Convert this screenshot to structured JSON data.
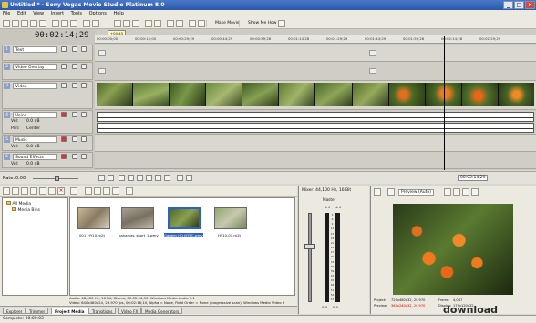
{
  "window": {
    "title": "Untitled * - Sony Vegas Movie Studio Platinum 8.0"
  },
  "menu": [
    "File",
    "Edit",
    "View",
    "Insert",
    "Tools",
    "Options",
    "Help"
  ],
  "toolbar": {
    "make_movie": "Make Movie",
    "show_me_how": "Show Me How"
  },
  "timecode": "00:02:14;29",
  "ruler_labels": [
    "00:00:00;00",
    "00:00:15;00",
    "00:00:29;29",
    "00:00:44;29",
    "00:00:59;28",
    "00:01:14;28",
    "00:01:29;29",
    "00:01:44;29",
    "00:01:59;28",
    "00:02:14;28",
    "00:02:29;29"
  ],
  "marker": "+00:45",
  "tracks": [
    {
      "num": "1",
      "name": "Text"
    },
    {
      "num": "2",
      "name": "Video Overlay"
    },
    {
      "num": "3",
      "name": "Video"
    },
    {
      "num": "4",
      "name": "Voice",
      "vol_label": "Vol:",
      "vol": "0.0 dB",
      "pan_label": "Pan:",
      "pan": "Center"
    },
    {
      "num": "5",
      "name": "Music",
      "vol_label": "Vol:",
      "vol": "0.0 dB"
    },
    {
      "num": "6",
      "name": "Sound Effects",
      "vol_label": "Vol:",
      "vol": "0.0 dB"
    }
  ],
  "rate": {
    "label": "Rate:",
    "value": "0.00"
  },
  "transport_time": "00:02:14;29",
  "explorer": {
    "tree": [
      "All Media",
      "Media Bins"
    ],
    "media": [
      {
        "name": "001_HY10.m2t"
      },
      {
        "name": "bahamas_short_1.wmv"
      },
      {
        "name": "Garden HQ NTSC.wmv"
      },
      {
        "name": "HY10-01.m2t"
      }
    ],
    "info_lines": [
      "Audio: 48,000 Hz, 16 Bit, Stereo, 00:02:16;10, Windows Media Audio 9.1",
      "Video: 640x480x24, 29.970 fps, 00:02:16;10, Alpha = None, Field Order = None (progressive scan), Windows Media Video 9"
    ]
  },
  "tabs": [
    "Explorer",
    "Trimmer",
    "Project Media",
    "Transitions",
    "Video FX",
    "Media Generators"
  ],
  "active_tab": "Project Media",
  "mixer": {
    "title": "Mixer: 44,100 Hz, 16 Bit",
    "master": "Master",
    "db_marks": [
      "-Inf",
      "-Inf"
    ],
    "scale": [
      "3",
      "6",
      "9",
      "12",
      "15",
      "18",
      "21",
      "24",
      "27",
      "30",
      "33",
      "36",
      "39",
      "42",
      "45",
      "48",
      "51",
      "54",
      "57"
    ],
    "level_left": "0.0",
    "level_right": "0.0"
  },
  "preview": {
    "mode": "Preview (Auto)",
    "project_label": "Project:",
    "project": "720x480x32, 29.970",
    "preview_label": "Preview:",
    "preview_val": "360x240x32, 29.970",
    "frame_label": "Frame:",
    "frame": "4,047",
    "display_label": "Display:",
    "display": "179x120x32"
  },
  "status": "Complete: 00:00:03",
  "watermark": "download"
}
